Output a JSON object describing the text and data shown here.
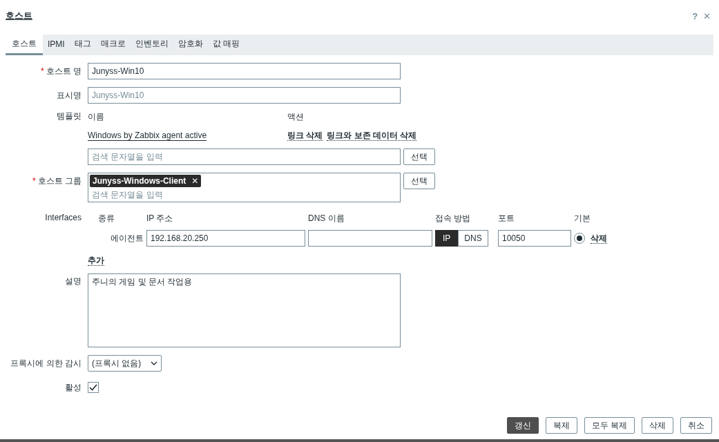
{
  "dialog": {
    "title": "호스트",
    "help": "?",
    "close": "✕"
  },
  "tabs": [
    {
      "label": "호스트",
      "selected": true
    },
    {
      "label": "IPMI",
      "selected": false
    },
    {
      "label": "태그",
      "selected": false
    },
    {
      "label": "매크로",
      "selected": false
    },
    {
      "label": "인벤토리",
      "selected": false
    },
    {
      "label": "암호화",
      "selected": false
    },
    {
      "label": "값 매핑",
      "selected": false
    }
  ],
  "host_name": {
    "label": "호스트 명",
    "required_mark": "*",
    "value": "Junyss-Win10"
  },
  "visible_name": {
    "label": "표시명",
    "placeholder": "Junyss-Win10"
  },
  "templates": {
    "label": "템플릿",
    "columns": [
      "이름",
      "액션"
    ],
    "linked": [
      {
        "name": "Windows by Zabbix agent active",
        "actions": [
          "링크 삭제",
          "링크와 보존 데이터 삭제"
        ]
      }
    ],
    "placeholder": "검색 문자열을 입력",
    "select_button": "선택"
  },
  "host_groups": {
    "label": "호스트 그룹",
    "required_mark": "*",
    "tags": [
      {
        "label": "Junyss-Windows-Client",
        "remove": "✕"
      }
    ],
    "placeholder": "검색 문자열을 입력",
    "select_button": "선택"
  },
  "interfaces": {
    "label": "Interfaces",
    "columns": [
      "종류",
      "IP 주소",
      "DNS 이름",
      "접속 방법",
      "포트",
      "기본"
    ],
    "rows": [
      {
        "type": "에이전트",
        "ip": "192.168.20.250",
        "dns": "",
        "connect": [
          {
            "label": "IP",
            "selected": true
          },
          {
            "label": "DNS",
            "selected": false
          }
        ],
        "port": "10050",
        "default": true,
        "remove": "삭제"
      }
    ],
    "add": "추가"
  },
  "description": {
    "label": "설명",
    "value": "주니의 게임 및 문서 작업용"
  },
  "proxy": {
    "label": "프록시에 의한 감시",
    "value": "(프록시 없음)"
  },
  "enabled": {
    "label": "활성",
    "checked": true
  },
  "buttons": [
    {
      "label": "갱신",
      "primary": true
    },
    {
      "label": "복제",
      "primary": false
    },
    {
      "label": "모두 복제",
      "primary": false
    },
    {
      "label": "삭제",
      "primary": false
    },
    {
      "label": "취소",
      "primary": false
    }
  ]
}
